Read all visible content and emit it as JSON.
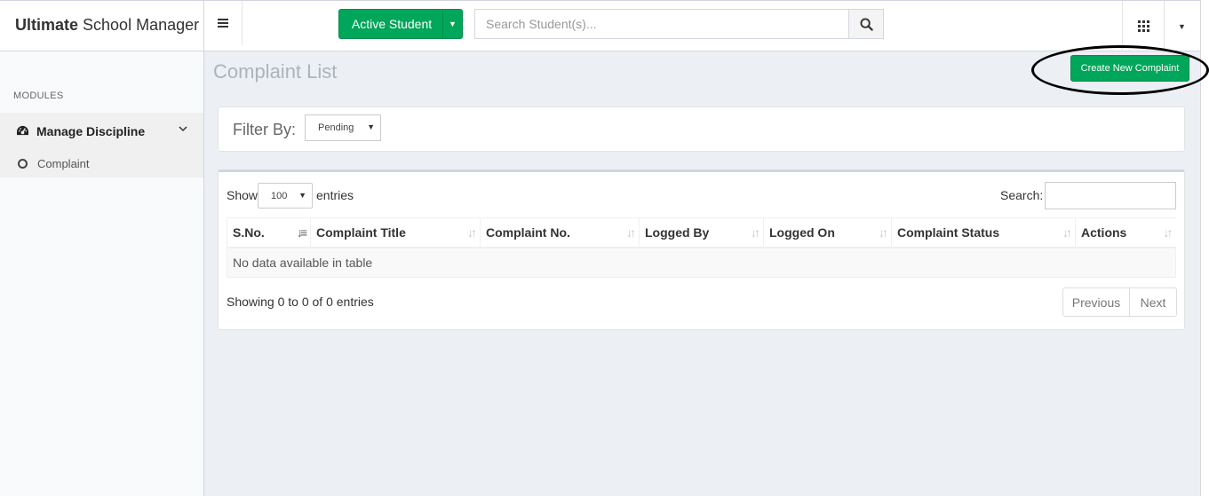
{
  "brand": {
    "bold": "Ultimate",
    "rest": "School Manager"
  },
  "header": {
    "active_button": "Active Student",
    "search_placeholder": "Search Student(s)..."
  },
  "sidebar": {
    "section": "MODULES",
    "menu_label": "Manage Discipline",
    "sub_label": "Complaint"
  },
  "page": {
    "title": "Complaint List",
    "create_button": "Create New Complaint",
    "filter_label": "Filter By:",
    "filter_value": "Pending"
  },
  "table": {
    "show_label": "Show",
    "page_length": "100",
    "entries_label": "entries",
    "search_label": "Search:",
    "columns": [
      "S.No.",
      "Complaint Title",
      "Complaint No.",
      "Logged By",
      "Logged On",
      "Complaint Status",
      "Actions"
    ],
    "empty_text": "No data available in table",
    "info": "Showing 0 to 0 of 0 entries",
    "previous": "Previous",
    "next": "Next"
  },
  "colors": {
    "primary_green": "#00a65a",
    "background": "#ecf0f5"
  },
  "icons": [
    "menu-icon",
    "caret-down-icon",
    "search-icon",
    "apps-grid-icon",
    "dashboard-icon",
    "chevron-down-icon",
    "circle-icon",
    "sort-icon"
  ]
}
